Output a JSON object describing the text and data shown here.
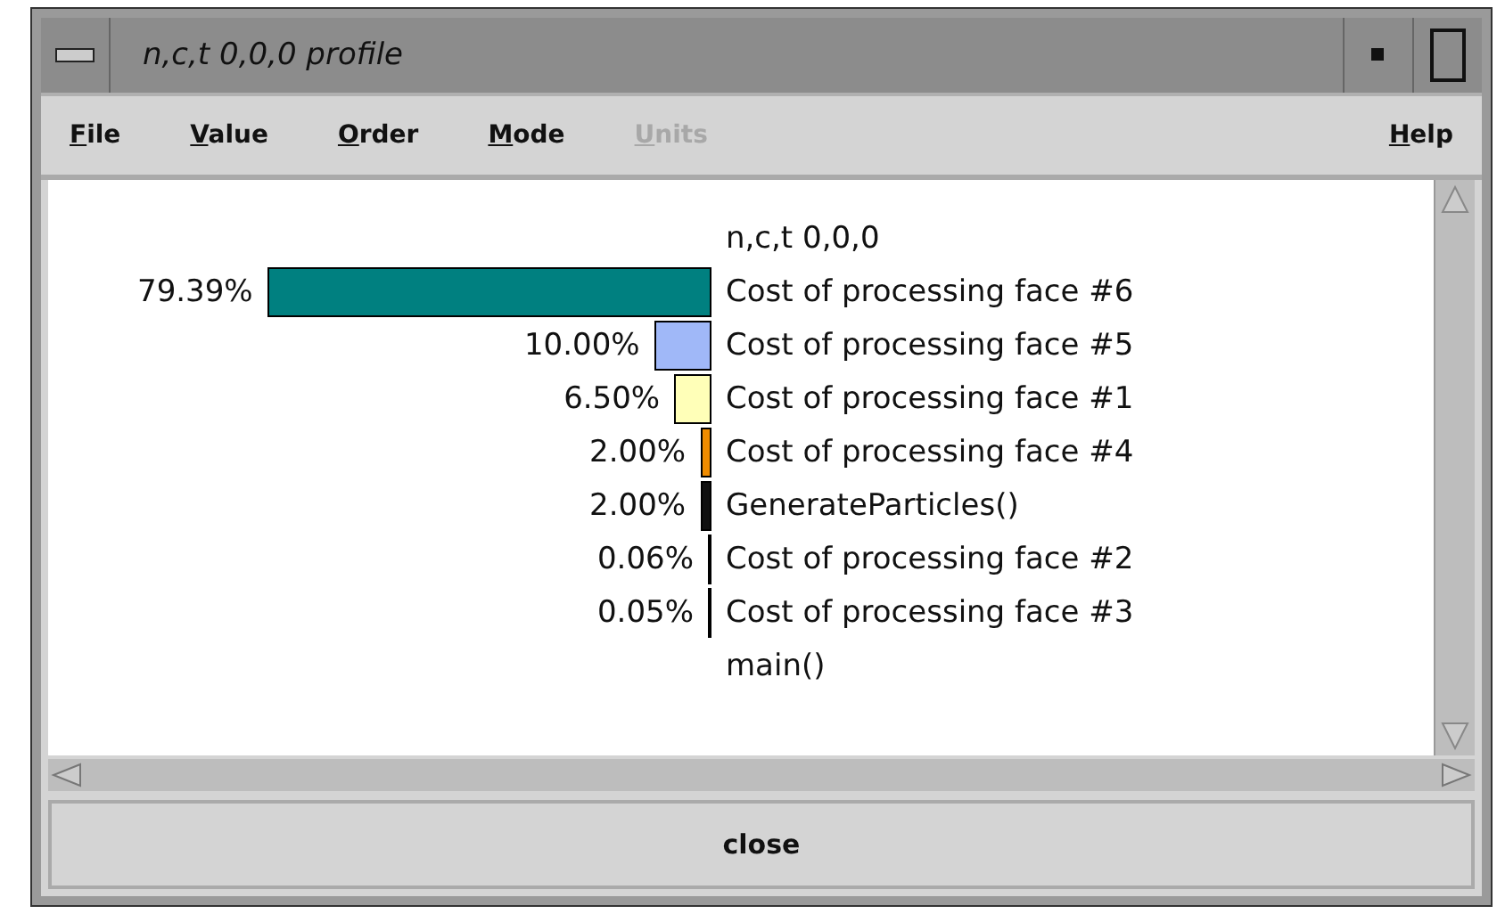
{
  "window": {
    "title": "n,c,t 0,0,0 profile"
  },
  "menu": [
    {
      "label": "File",
      "disabled": false
    },
    {
      "label": "Value",
      "disabled": false
    },
    {
      "label": "Order",
      "disabled": false
    },
    {
      "label": "Mode",
      "disabled": false
    },
    {
      "label": "Units",
      "disabled": true
    }
  ],
  "help_menu": {
    "label": "Help"
  },
  "profile": {
    "header": "n,c,t 0,0,0",
    "rows": [
      {
        "percent": "79.39%",
        "color": "#008080",
        "label": "Cost of processing face #6"
      },
      {
        "percent": "10.00%",
        "color": "#a0b8f8",
        "label": "Cost of processing face #5"
      },
      {
        "percent": "6.50%",
        "color": "#ffffb8",
        "label": "Cost of processing face #1"
      },
      {
        "percent": "2.00%",
        "color": "#f08c00",
        "label": "Cost of processing face #4"
      },
      {
        "percent": "2.00%",
        "color": "#101010",
        "label": "GenerateParticles()"
      },
      {
        "percent": "0.06%",
        "color": "#000000",
        "label": "Cost of processing face #2"
      },
      {
        "percent": "0.05%",
        "color": "#000000",
        "label": "Cost of processing face #3"
      }
    ],
    "footer": "main()"
  },
  "close_button": "close"
}
